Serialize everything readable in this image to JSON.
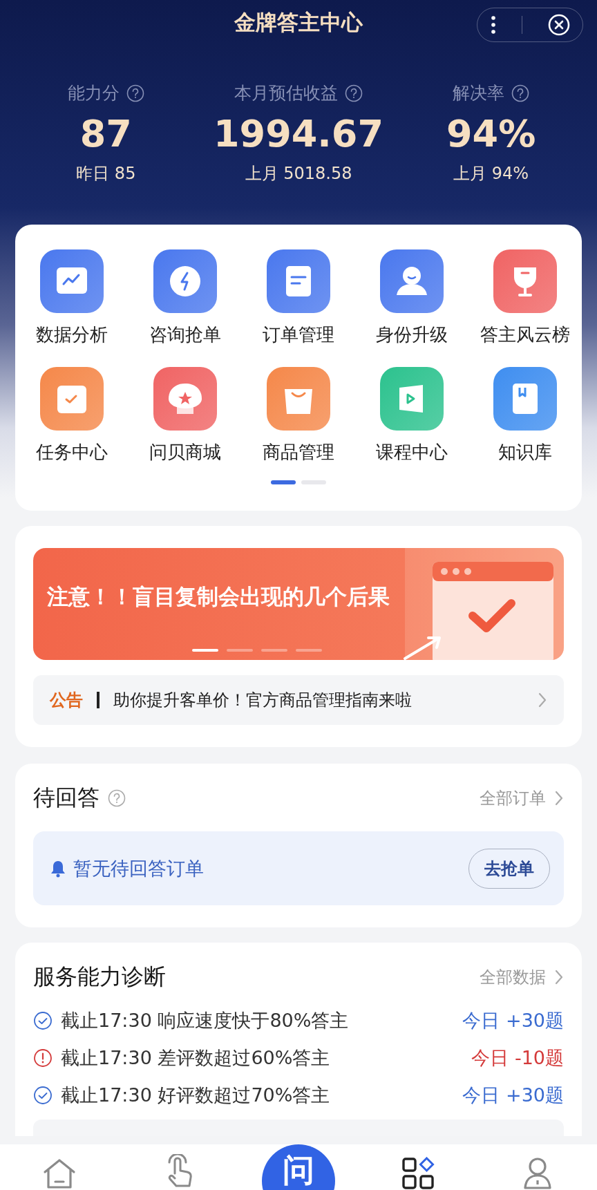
{
  "header": {
    "title": "金牌答主中心"
  },
  "stats": [
    {
      "label": "能力分",
      "value": "87",
      "sub": "昨日 85"
    },
    {
      "label": "本月预估收益",
      "value": "1994.67",
      "sub": "上月 5018.58"
    },
    {
      "label": "解决率",
      "value": "94%",
      "sub": "上月 94%"
    }
  ],
  "shortcuts": [
    {
      "label": "数据分析",
      "color": "#4a78ee"
    },
    {
      "label": "咨询抢单",
      "color": "#4a78ee"
    },
    {
      "label": "订单管理",
      "color": "#4a78ee"
    },
    {
      "label": "身份升级",
      "color": "#4a78ee"
    },
    {
      "label": "答主风云榜",
      "color": "#f06464"
    },
    {
      "label": "任务中心",
      "color": "#f5884a"
    },
    {
      "label": "问贝商城",
      "color": "#f06464"
    },
    {
      "label": "商品管理",
      "color": "#f5884a"
    },
    {
      "label": "课程中心",
      "color": "#2cc28e"
    },
    {
      "label": "知识库",
      "color": "#3f8ef0"
    }
  ],
  "shortcut_pages": [
    {
      "selected": true
    },
    {
      "selected": false
    }
  ],
  "banner": {
    "text": "注意！！盲目复制会出现的几个后果",
    "pages": [
      {
        "selected": true
      },
      {
        "selected": false
      },
      {
        "selected": false
      },
      {
        "selected": false
      }
    ]
  },
  "notice": {
    "tag": "公告",
    "text": "助你提升客单价！官方商品管理指南来啦"
  },
  "pending": {
    "title": "待回答",
    "link": "全部订单",
    "empty_text": "暂无待回答订单",
    "button": "去抢单"
  },
  "diagnosis": {
    "title": "服务能力诊断",
    "link": "全部数据",
    "rows": [
      {
        "kind": "good",
        "text": "截止17:30 响应速度快于80%答主",
        "delta": "今日 +30题"
      },
      {
        "kind": "bad",
        "text": "截止17:30 差评数超过60%答主",
        "delta": "今日 -10题"
      },
      {
        "kind": "good",
        "text": "截止17:30 好评数超过70%答主",
        "delta": "今日 +30题"
      }
    ]
  },
  "nav": [
    {
      "kind": "home",
      "selected": false
    },
    {
      "kind": "tap",
      "selected": false
    },
    {
      "kind": "ask",
      "label": "问",
      "selected": false
    },
    {
      "kind": "apps",
      "selected": true
    },
    {
      "kind": "profile",
      "selected": false
    }
  ]
}
